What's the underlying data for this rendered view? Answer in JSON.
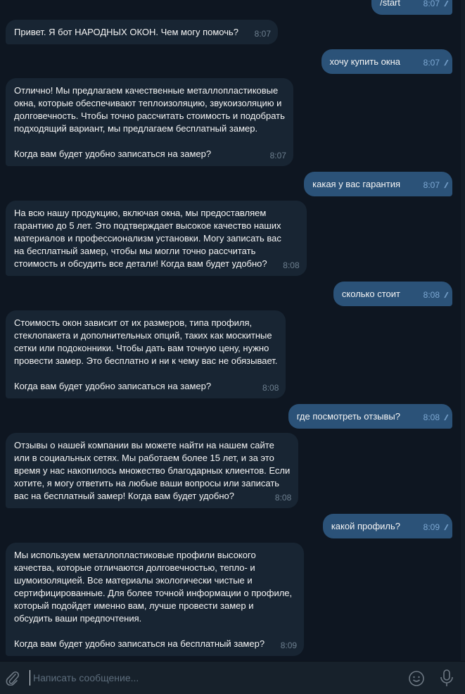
{
  "chat": {
    "messages": [
      {
        "side": "out",
        "text": "/start",
        "time": "8:07",
        "status": "read"
      },
      {
        "side": "in",
        "text": "Привет. Я бот НАРОДНЫХ ОКОН. Чем могу помочь?",
        "time": "8:07"
      },
      {
        "side": "out",
        "text": "хочу купить окна",
        "time": "8:07",
        "status": "read"
      },
      {
        "side": "in",
        "text": "Отлично! Мы предлагаем качественные металлопластиковые\nокна, которые обеспечивают теплоизоляцию, звукоизоляцию и\nдолговечность. Чтобы точно рассчитать стоимость и подобрать\nподходящий вариант, мы предлагаем бесплатный замер.\n\nКогда вам будет удобно записаться на замер?",
        "time": "8:07"
      },
      {
        "side": "out",
        "text": "какая у вас гарантия",
        "time": "8:07",
        "status": "read"
      },
      {
        "side": "in",
        "text": "На всю нашу продукцию, включая окна, мы предоставляем\nгарантию до 5 лет. Это подтверждает высокое качество наших\nматериалов и профессионализм установки. Могу записать вас\nна бесплатный замер, чтобы мы могли точно рассчитать\nстоимость и обсудить все детали! Когда вам будет удобно?",
        "time": "8:08"
      },
      {
        "side": "out",
        "text": "сколько стоит",
        "time": "8:08",
        "status": "read"
      },
      {
        "side": "in",
        "text": "Стоимость окон зависит от их размеров, типа профиля,\nстеклопакета и дополнительных опций, таких как москитные\nсетки или подоконники. Чтобы дать вам точную цену, нужно\nпровести замер. Это бесплатно и ни к чему вас не обязывает.\n\nКогда вам будет удобно записаться на замер?",
        "time": "8:08"
      },
      {
        "side": "out",
        "text": "где посмотреть отзывы?",
        "time": "8:08",
        "status": "read"
      },
      {
        "side": "in",
        "text": "Отзывы о нашей компании вы можете найти на нашем сайте\nили в социальных сетях. Мы работаем более 15 лет, и за это\nвремя у нас накопилось множество благодарных клиентов. Если\nхотите, я могу ответить на любые ваши вопросы или записать\nвас на бесплатный замер! Когда вам будет удобно?",
        "time": "8:08"
      },
      {
        "side": "out",
        "text": "какой профиль?",
        "time": "8:09",
        "status": "read"
      },
      {
        "side": "in",
        "text": "Мы используем металлопластиковые профили высокого\nкачества, которые отличаются долговечностью, тепло- и\nшумоизоляцией. Все материалы экологически чистые и\nсертифицированные. Для более точной информации о профиле,\nкоторый подойдет именно вам, лучше провести замер и\nобсудить ваши предпочтения.\n\nКогда вам будет удобно записаться на бесплатный замер?",
        "time": "8:09"
      }
    ]
  },
  "composer": {
    "placeholder": "Написать сообщение...",
    "icons": [
      "paperclip-icon",
      "emoji-icon",
      "microphone-icon"
    ]
  },
  "colors": {
    "background": "#0e1621",
    "incoming": "#182533",
    "outgoing": "#2b5278",
    "composer": "#17212b"
  }
}
